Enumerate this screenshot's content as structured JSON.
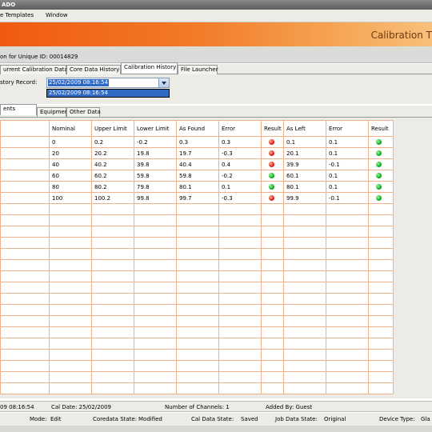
{
  "window": {
    "title": "ADO"
  },
  "menu": {
    "items": [
      "e Templates",
      "Window"
    ]
  },
  "banner": {
    "title": "Calibration T"
  },
  "unit": {
    "text": "on for Unique ID: 00014829"
  },
  "tabs": [
    "urrent Calibration Data",
    "Core Data History",
    "Calibration History",
    "File Launcher"
  ],
  "record": {
    "label": "story Record:",
    "value": "25/02/2009 08:16:54",
    "option": "25/02/2009 08:16:54"
  },
  "subtabs": [
    "ents",
    "Equipment Used",
    "Other Data"
  ],
  "grid": {
    "headers": [
      "",
      "Nominal",
      "Upper Limit",
      "Lower Limit",
      "As Found",
      "Error",
      "Result",
      "As Left",
      "Error",
      "Result"
    ],
    "rows": [
      {
        "nominal": "0",
        "upper": "0.2",
        "lower": "-0.2",
        "found": "0.3",
        "error1": "0.3",
        "result1": "red",
        "left": "0.1",
        "error2": "0.1",
        "result2": "green"
      },
      {
        "nominal": "20",
        "upper": "20.2",
        "lower": "19.8",
        "found": "19.7",
        "error1": "-0.3",
        "result1": "red",
        "left": "20.1",
        "error2": "0.1",
        "result2": "green"
      },
      {
        "nominal": "40",
        "upper": "40.2",
        "lower": "39.8",
        "found": "40.4",
        "error1": "0.4",
        "result1": "red",
        "left": "39.9",
        "error2": "-0.1",
        "result2": "green"
      },
      {
        "nominal": "60",
        "upper": "60.2",
        "lower": "59.8",
        "found": "59.8",
        "error1": "-0.2",
        "result1": "green",
        "left": "60.1",
        "error2": "0.1",
        "result2": "green"
      },
      {
        "nominal": "80",
        "upper": "80.2",
        "lower": "79.8",
        "found": "80.1",
        "error1": "0.1",
        "result1": "green",
        "left": "80.1",
        "error2": "0.1",
        "result2": "green"
      },
      {
        "nominal": "100",
        "upper": "100.2",
        "lower": "99.8",
        "found": "99.7",
        "error1": "-0.3",
        "result1": "red",
        "left": "99.9",
        "error2": "-0.1",
        "result2": "green"
      }
    ]
  },
  "status1": {
    "datetime": "09 08:16:54",
    "cal_date": "Cal Date: 25/02/2009",
    "channels": "Number of Channels: 1",
    "added_by": "Added By: Guest"
  },
  "status2": {
    "mode_label": "Mode:",
    "mode": "Edit",
    "coredata_label": "Coredata State:",
    "coredata": "Modified",
    "caldata_label": "Cal Data State:",
    "caldata": "Saved",
    "jobdata_label": "Job Data State:",
    "jobdata": "Original",
    "device_label": "Device Type:",
    "device": "Gla"
  },
  "colors": {
    "banner": "#f05a12",
    "grid_border": "#f0b088",
    "selection": "#316ac5",
    "fail": "#e02010",
    "pass": "#10b020"
  }
}
